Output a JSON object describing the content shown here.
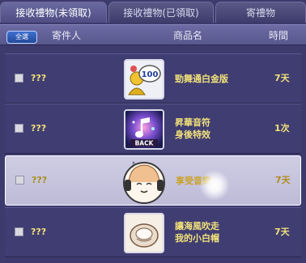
{
  "tabs": [
    {
      "label": "接收禮物(未領取)"
    },
    {
      "label": "接收禮物(已領取)"
    },
    {
      "label": "寄禮物"
    }
  ],
  "header": {
    "select_all_label": "全選",
    "sender_label": "寄件人",
    "item_label": "商品名",
    "time_label": "時間"
  },
  "rows": [
    {
      "sender": "???",
      "item_name": "勁舞通白金版",
      "duration": "7天",
      "icon": "platinum-100-badge-icon"
    },
    {
      "sender": "???",
      "item_name": "昇華音符\n身後特效",
      "duration": "1次",
      "icon": "music-note-back-effect-icon"
    },
    {
      "sender": "???",
      "item_name": "享受音樂",
      "duration": "7天",
      "icon": "headphones-girl-emote-icon"
    },
    {
      "sender": "???",
      "item_name": "讓海風吹走\n我的小白帽",
      "duration": "7天",
      "icon": "white-hat-icon"
    }
  ],
  "colors": {
    "background": "#3d3a6e",
    "accent_text": "#f2e27a",
    "selected_row": "#cfcde4"
  }
}
